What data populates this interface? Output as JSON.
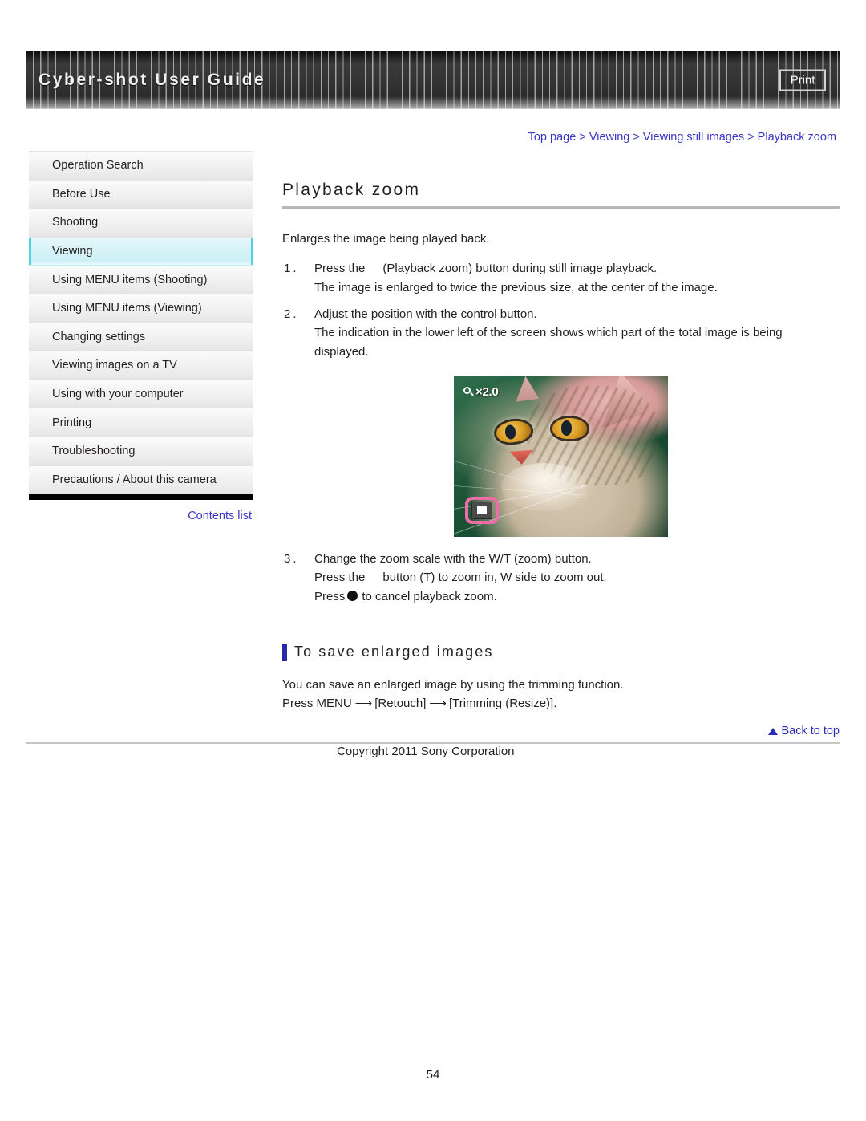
{
  "header": {
    "title": "Cyber-shot User Guide",
    "print_label": "Print"
  },
  "breadcrumb": {
    "items": [
      "Top page",
      "Viewing",
      "Viewing still images",
      "Playback zoom"
    ],
    "separator": ">"
  },
  "sidebar": {
    "items": [
      {
        "label": "Operation Search",
        "active": false
      },
      {
        "label": "Before Use",
        "active": false
      },
      {
        "label": "Shooting",
        "active": false
      },
      {
        "label": "Viewing",
        "active": true
      },
      {
        "label": "Using MENU items (Shooting)",
        "active": false
      },
      {
        "label": "Using MENU items (Viewing)",
        "active": false
      },
      {
        "label": "Changing settings",
        "active": false
      },
      {
        "label": "Viewing images on a TV",
        "active": false
      },
      {
        "label": "Using with your computer",
        "active": false
      },
      {
        "label": "Printing",
        "active": false
      },
      {
        "label": "Troubleshooting",
        "active": false
      },
      {
        "label": "Precautions / About this camera",
        "active": false
      }
    ],
    "contents_list_label": "Contents list",
    "accent_color": "#4fd2e3",
    "link_color": "#3a35c4"
  },
  "main": {
    "title": "Playback zoom",
    "lead": "Enlarges the image being played back.",
    "steps": [
      {
        "number": "1.",
        "text_before_icon": "Press the",
        "text_after_icon": "(Playback zoom) button during still image playback.",
        "sub": "The image is enlarged to twice the previous size, at the center of the image."
      },
      {
        "number": "2.",
        "text": "Adjust the position with the control button.",
        "sub": "The indication in the lower left of the screen shows which part of the total image is being displayed."
      },
      {
        "number": "3.",
        "text": "Change the zoom scale with the W/T (zoom) button.",
        "sub_a_before_icon": "Press the",
        "sub_a_after_icon": "button (T) to zoom in, W side to zoom out.",
        "sub_b_before_disc": "Press",
        "sub_b_after_disc": "to cancel playback zoom."
      }
    ],
    "figure": {
      "zoom_label": "×2.0",
      "magnifier_icon": "magnifier-icon",
      "position_indicator_color": "#f06ca8"
    },
    "subhead": "To save enlarged images",
    "subhead_bar_color": "#2a2aa8",
    "save_paragraph_1": "You can save an enlarged image by using the trimming function.",
    "save_paragraph_2_a": "Press MENU",
    "save_paragraph_2_b": "[Retouch]",
    "save_paragraph_2_c": "[Trimming (Resize)].",
    "arrow": "⟶"
  },
  "footer": {
    "back_to_top": "Back to top",
    "copyright": "Copyright 2011 Sony Corporation",
    "page_number": "54"
  }
}
